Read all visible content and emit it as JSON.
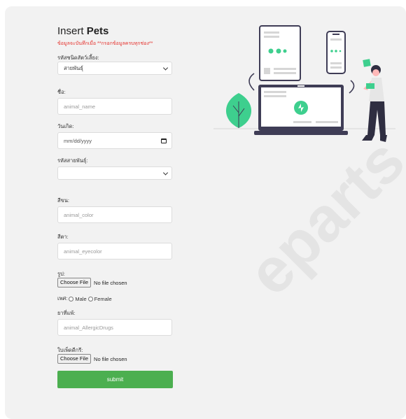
{
  "form": {
    "title_prefix": "Insert ",
    "title_bold": "Pets",
    "note": "ข้อมูลจะบันทึกเมื่อ **กรอกข้อมูลครบทุกช่อง**",
    "pet_type_label": "รหัสชนิดสัตว์เลี้ยง:",
    "pet_type_value": "สายพันธุ์",
    "name_label": "ชื่อ:",
    "name_placeholder": "animal_name",
    "birthdate_label": "วันเกิด:",
    "birthdate_placeholder": "mm/dd/yyyy",
    "breed_label": "รหัสสายพันธุ์:",
    "breed_value": "",
    "color_label": "สีขน:",
    "color_placeholder": "animal_color",
    "eyecolor_label": "สีตา:",
    "eyecolor_placeholder": "animal_eyecolor",
    "photo_label": "รูป:",
    "choose_file": "Choose File",
    "no_file": "No file chosen",
    "gender_label": "เพศ:",
    "male": "Male",
    "female": "Female",
    "allergy_label": "ยาที่แพ้:",
    "allergy_placeholder": "animal_AllergicDrugs",
    "certificate_label": "ใบเพ็ดดีกรี:",
    "submit_label": "submit"
  },
  "colors": {
    "accent_green": "#4caf50",
    "note_red": "#e5322d",
    "illustration_dark": "#3f3d56",
    "illustration_green": "#3ecf8e"
  },
  "watermark": "eparts"
}
